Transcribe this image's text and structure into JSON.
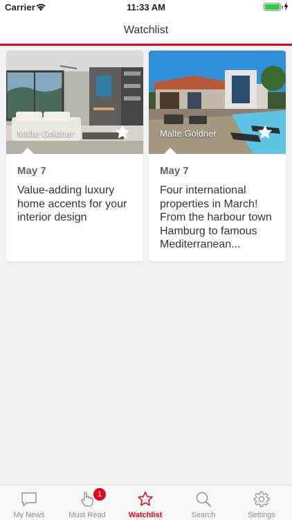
{
  "status_bar": {
    "carrier": "Carrier",
    "time": "11:33 AM",
    "battery_level": 1.0
  },
  "nav": {
    "title": "Watchlist"
  },
  "cards": [
    {
      "author": "Malte  Goldner",
      "date": "May 7",
      "title": "Value-adding luxury home accents for your interior design",
      "image": "living-room-photo",
      "starred": true
    },
    {
      "author": "Malte Goldner",
      "date": "May 7",
      "title": "Four international properties in March! From the harbour town Hamburg to famous Mediterranean...",
      "image": "villa-pool-photo",
      "starred": true
    }
  ],
  "tab_bar": {
    "items": [
      {
        "label": "My News",
        "icon": "chat-bubble-icon",
        "active": false
      },
      {
        "label": "Must Read",
        "icon": "hand-pointer-icon",
        "active": false,
        "badge": "1"
      },
      {
        "label": "Watchlist",
        "icon": "star-outline-icon",
        "active": true
      },
      {
        "label": "Search",
        "icon": "magnifier-icon",
        "active": false
      },
      {
        "label": "Settings",
        "icon": "gear-icon",
        "active": false
      }
    ]
  },
  "colors": {
    "accent": "#e3001b",
    "background": "#f2f2f4",
    "inactive_tab": "#8e8e8e"
  }
}
